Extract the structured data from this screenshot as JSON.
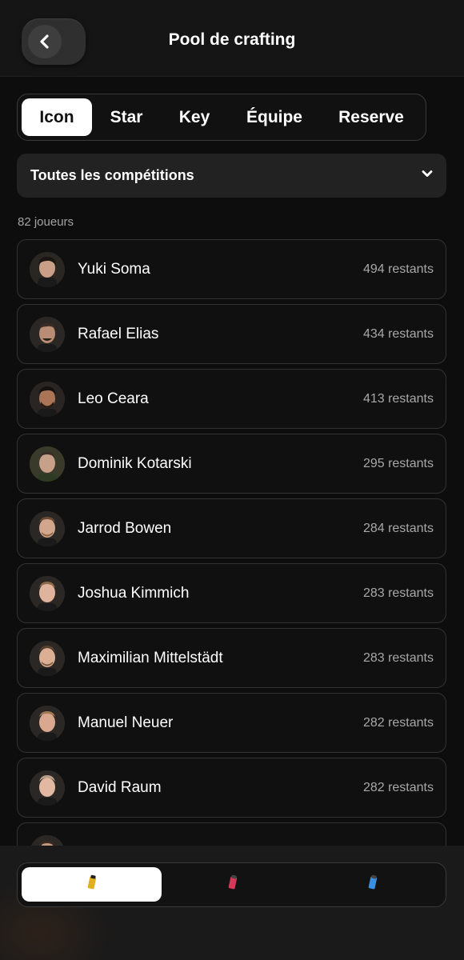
{
  "header": {
    "title": "Pool de crafting",
    "back_icon": "chevron-left-icon"
  },
  "tabs": [
    {
      "label": "Icon",
      "active": true
    },
    {
      "label": "Star",
      "active": false
    },
    {
      "label": "Key",
      "active": false
    },
    {
      "label": "Équipe",
      "active": false
    },
    {
      "label": "Reserve",
      "active": false
    }
  ],
  "competition": {
    "selected": "Toutes les compétitions",
    "icon": "chevron-down-icon"
  },
  "players_count": "82 joueurs",
  "players": [
    {
      "name": "Yuki Soma",
      "remaining": "494 restants"
    },
    {
      "name": "Rafael Elias",
      "remaining": "434 restants"
    },
    {
      "name": "Leo Ceara",
      "remaining": "413 restants"
    },
    {
      "name": "Dominik Kotarski",
      "remaining": "295 restants"
    },
    {
      "name": "Jarrod Bowen",
      "remaining": "284 restants"
    },
    {
      "name": "Joshua Kimmich",
      "remaining": "283 restants"
    },
    {
      "name": "Maximilian Mittelstädt",
      "remaining": "283 restants"
    },
    {
      "name": "Manuel Neuer",
      "remaining": "282 restants"
    },
    {
      "name": "David Raum",
      "remaining": "282 restants"
    }
  ],
  "bottom_nav": [
    {
      "icon": "yellow-card-pack-icon",
      "active": true,
      "color": "#e0b020"
    },
    {
      "icon": "red-card-pack-icon",
      "active": false,
      "color": "#d6385a"
    },
    {
      "icon": "blue-card-pack-icon",
      "active": false,
      "color": "#3a8fe0"
    }
  ],
  "colors": {
    "background": "#0d0d0d",
    "surface": "#222222",
    "active_tab": "#ffffff"
  }
}
